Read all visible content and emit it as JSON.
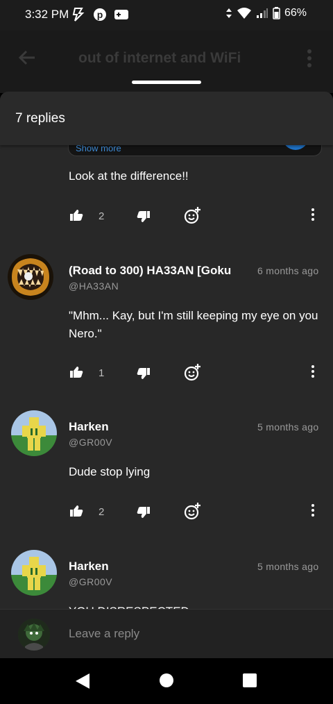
{
  "status": {
    "time": "3:32 PM",
    "battery": "66%"
  },
  "background_app": {
    "title": "out of internet and WiFi"
  },
  "sheet": {
    "title": "7 replies"
  },
  "previous_comment": {
    "show_more": "Show more",
    "text": "Look at the difference!!",
    "likes": "2"
  },
  "replies": [
    {
      "author": "(Road to 300) HA33AN [Goku",
      "handle": "@HA33AN",
      "time": "6 months ago",
      "text": "\"Mhm... Kay, but I'm still keeping my eye on you Nero.\"",
      "likes": "1"
    },
    {
      "author": "Harken",
      "handle": "@GR00V",
      "time": "5 months ago",
      "text": "Dude stop lying",
      "likes": "2"
    },
    {
      "author": "Harken",
      "handle": "@GR00V",
      "time": "5 months ago",
      "text": "YOU DISRESPECTED"
    }
  ],
  "reply_bar": {
    "placeholder": "Leave a reply"
  },
  "colors": {
    "sheet_bg": "#282828",
    "link": "#3e8bd6",
    "secondary_text": "#9a9a9a"
  }
}
